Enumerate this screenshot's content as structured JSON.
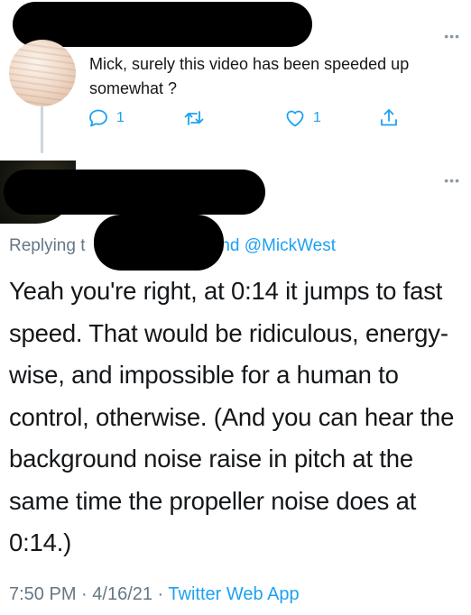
{
  "first_reply": {
    "text": "Mick, surely this video has been speeded up somewhat ?",
    "more_label": "•••",
    "actions": {
      "reply_count": "1",
      "retweet_count": "",
      "like_count": "1"
    }
  },
  "main_tweet": {
    "more_label": "•••",
    "replying_prefix": "Replying t",
    "replying_suffix": " and @MickWest",
    "text": "Yeah you're right, at 0:14 it jumps to fast speed. That would be ridiculous, energy-wise, and impossible for a human to control, otherwise. (And you can hear the background noise raise in pitch at the same time the propeller noise does at 0:14.)",
    "time": "7:50 PM",
    "separator": " · ",
    "date": "4/16/21",
    "app": "Twitter Web App"
  },
  "colors": {
    "accent": "#1da1f2",
    "muted": "#657786",
    "text": "#14171a",
    "redaction": "#000000"
  },
  "icons": [
    "reply-icon",
    "retweet-icon",
    "like-icon",
    "share-icon",
    "more-icon"
  ]
}
